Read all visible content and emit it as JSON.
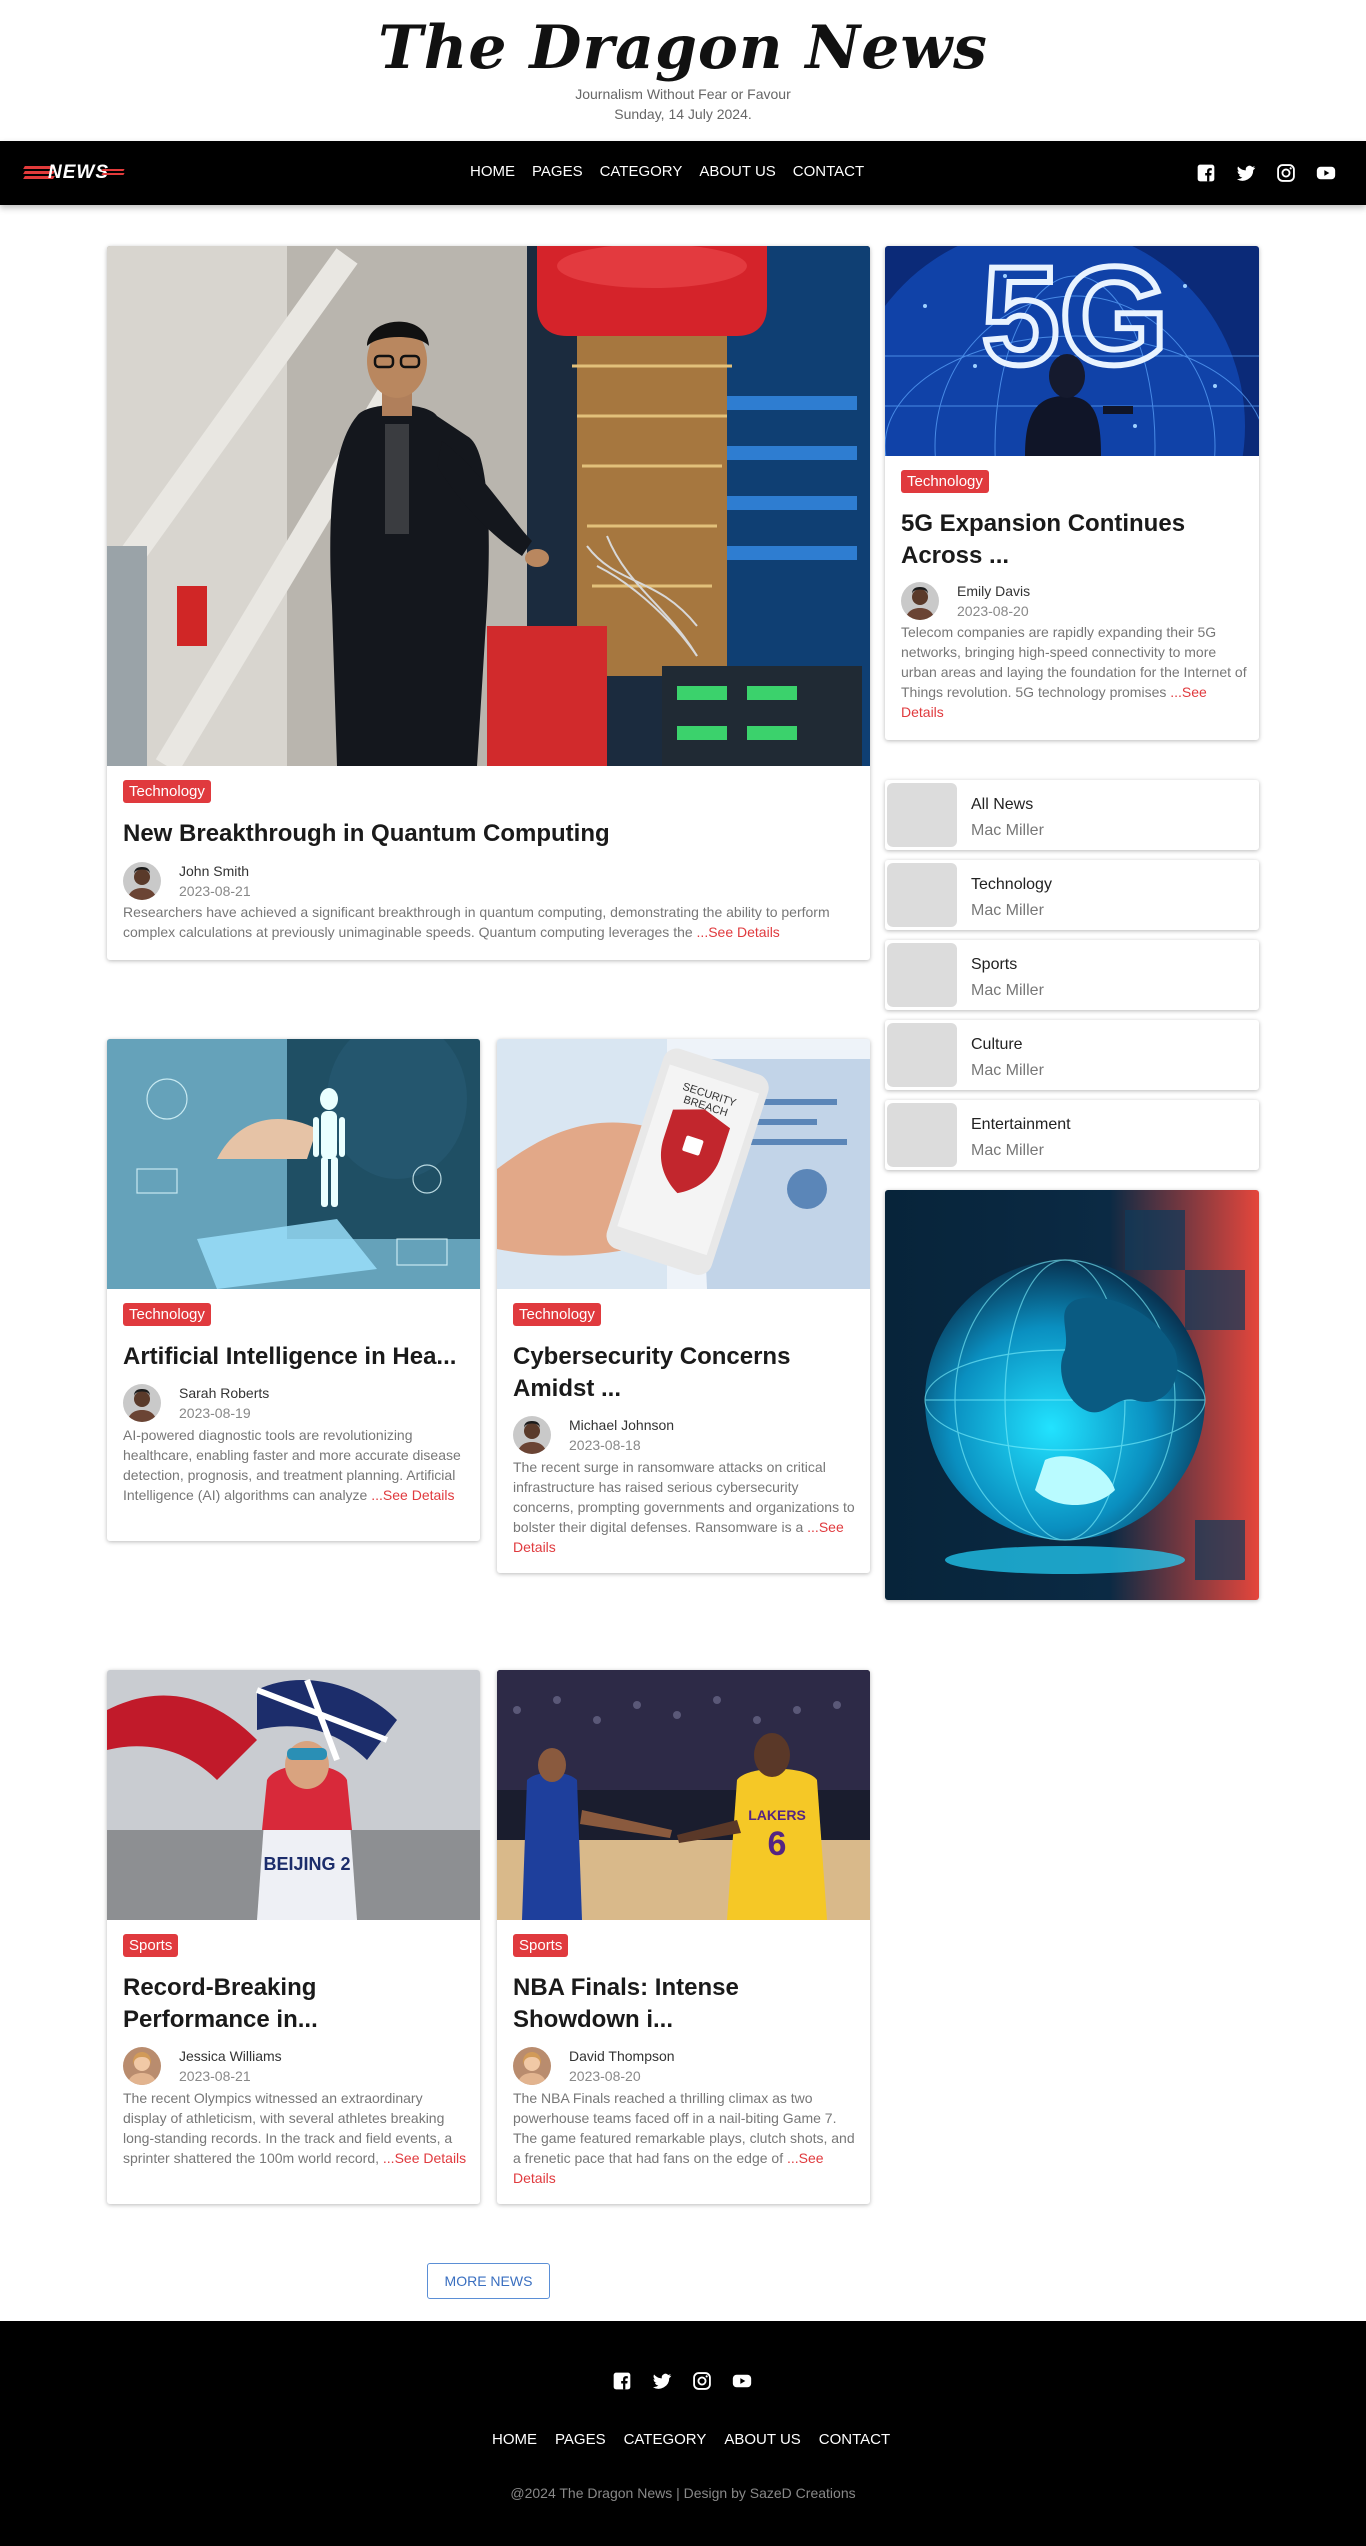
{
  "site": {
    "name": "The Dragon News",
    "tagline": "Journalism Without Fear or Favour",
    "date": "Sunday, 14 July 2024."
  },
  "nav": {
    "logo_text": "NEWS",
    "links": [
      "HOME",
      "PAGES",
      "CATEGORY",
      "ABOUT US",
      "CONTACT"
    ],
    "social": [
      "facebook-icon",
      "twitter-icon",
      "instagram-icon",
      "youtube-icon"
    ]
  },
  "featured": {
    "category": "Technology",
    "title": "New Breakthrough in Quantum Computing",
    "author": "John Smith",
    "date": "2023-08-21",
    "excerpt": "Researchers have achieved a significant breakthrough in quantum computing, demonstrating the ability to perform complex calculations at previously unimaginable speeds. Quantum computing leverages the ",
    "see": "...See Details"
  },
  "side_article": {
    "category": "Technology",
    "title": "5G Expansion Continues Across ...",
    "image_text": "5G",
    "author": "Emily Davis",
    "date": "2023-08-20",
    "excerpt": "Telecom companies are rapidly expanding their 5G networks, bringing high-speed connectivity to more urban areas and laying the foundation for the Internet of Things revolution. 5G technology promises ",
    "see": "...See Details"
  },
  "categories": [
    {
      "name": "All News",
      "sub": "Mac Miller"
    },
    {
      "name": "Technology",
      "sub": "Mac Miller"
    },
    {
      "name": "Sports",
      "sub": "Mac Miller"
    },
    {
      "name": "Culture",
      "sub": "Mac Miller"
    },
    {
      "name": "Entertainment",
      "sub": "Mac Miller"
    }
  ],
  "articles": [
    {
      "category": "Technology",
      "title": "Artificial Intelligence in Hea...",
      "author": "Sarah Roberts",
      "date": "2023-08-19",
      "excerpt": "AI-powered diagnostic tools are revolutionizing healthcare, enabling faster and more accurate disease detection, prognosis, and treatment planning. Artificial Intelligence (AI) algorithms can analyze ",
      "see": "...See Details"
    },
    {
      "category": "Technology",
      "title": "Cybersecurity Concerns Amidst ...",
      "author": "Michael Johnson",
      "date": "2023-08-18",
      "excerpt": "The recent surge in ransomware attacks on critical infrastructure has raised serious cybersecurity concerns, prompting governments and organizations to bolster their digital defenses. Ransomware is a ",
      "see": "...See Details",
      "phone_text_1": "SECURITY",
      "phone_text_2": "BREACH"
    },
    {
      "category": "Sports",
      "title": "Record-Breaking Performance in...",
      "author": "Jessica Williams",
      "date": "2023-08-21",
      "excerpt": "The recent Olympics witnessed an extraordinary display of athleticism, with several athletes breaking long-standing records. In the track and field events, a sprinter shattered the 100m world record, ",
      "see": "...See Details",
      "bib_text": "BEIJING 2"
    },
    {
      "category": "Sports",
      "title": "NBA Finals: Intense Showdown i...",
      "author": "David Thompson",
      "date": "2023-08-20",
      "excerpt": "The NBA Finals reached a thrilling climax as two powerhouse teams faced off in a nail-biting Game 7. The game featured remarkable plays, clutch shots, and a frenetic pace that had fans on the edge of ",
      "see": "...See Details",
      "jersey_text": "LAKERS",
      "jersey_number": "6"
    }
  ],
  "more_button": "MORE NEWS",
  "footer": {
    "links": [
      "HOME",
      "PAGES",
      "CATEGORY",
      "ABOUT US",
      "CONTACT"
    ],
    "copyright": "@2024 The Dragon News | Design by SazeD Creations"
  },
  "colors": {
    "accent": "#e03a3e",
    "nav_bg": "#000000",
    "link_blue": "#3a6fc0"
  }
}
